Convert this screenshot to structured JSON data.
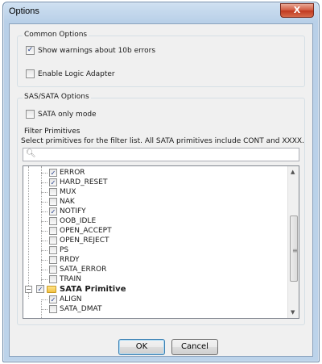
{
  "window": {
    "title": "Options",
    "close_glyph": "X"
  },
  "common_options": {
    "label": "Common Options",
    "show_warnings": {
      "label": "Show warnings about 10b errors",
      "checked": true
    },
    "enable_logic_adapter": {
      "label": "Enable Logic Adapter",
      "checked": false
    }
  },
  "sas_sata_options": {
    "label": "SAS/SATA Options",
    "sata_only_mode": {
      "label": "SATA only mode",
      "checked": false
    }
  },
  "filter_primitives": {
    "label": "Filter Primitives",
    "description": "Select primitives for the filter list. All SATA primitives include CONT and XXXX.",
    "search": {
      "value": "",
      "icon": "search-icon"
    },
    "tree_items": [
      {
        "label": "ERROR",
        "checked": true
      },
      {
        "label": "HARD_RESET",
        "checked": true
      },
      {
        "label": "MUX",
        "checked": false
      },
      {
        "label": "NAK",
        "checked": false
      },
      {
        "label": "NOTIFY",
        "checked": true
      },
      {
        "label": "OOB_IDLE",
        "checked": false
      },
      {
        "label": "OPEN_ACCEPT",
        "checked": false
      },
      {
        "label": "OPEN_REJECT",
        "checked": false
      },
      {
        "label": "PS",
        "checked": false
      },
      {
        "label": "RRDY",
        "checked": false
      },
      {
        "label": "SATA_ERROR",
        "checked": false
      },
      {
        "label": "TRAIN",
        "checked": false
      }
    ],
    "folder": {
      "label": "SATA Primitive",
      "checked": true,
      "expander": "−"
    },
    "folder_items": [
      {
        "label": "ALIGN",
        "checked": true
      },
      {
        "label": "SATA_DMAT",
        "checked": false
      }
    ]
  },
  "buttons": {
    "ok": "OK",
    "cancel": "Cancel"
  },
  "colors": {
    "accent": "#3c7fb1",
    "title_bar": "#b9d0e8",
    "close_button": "#c1391f"
  }
}
